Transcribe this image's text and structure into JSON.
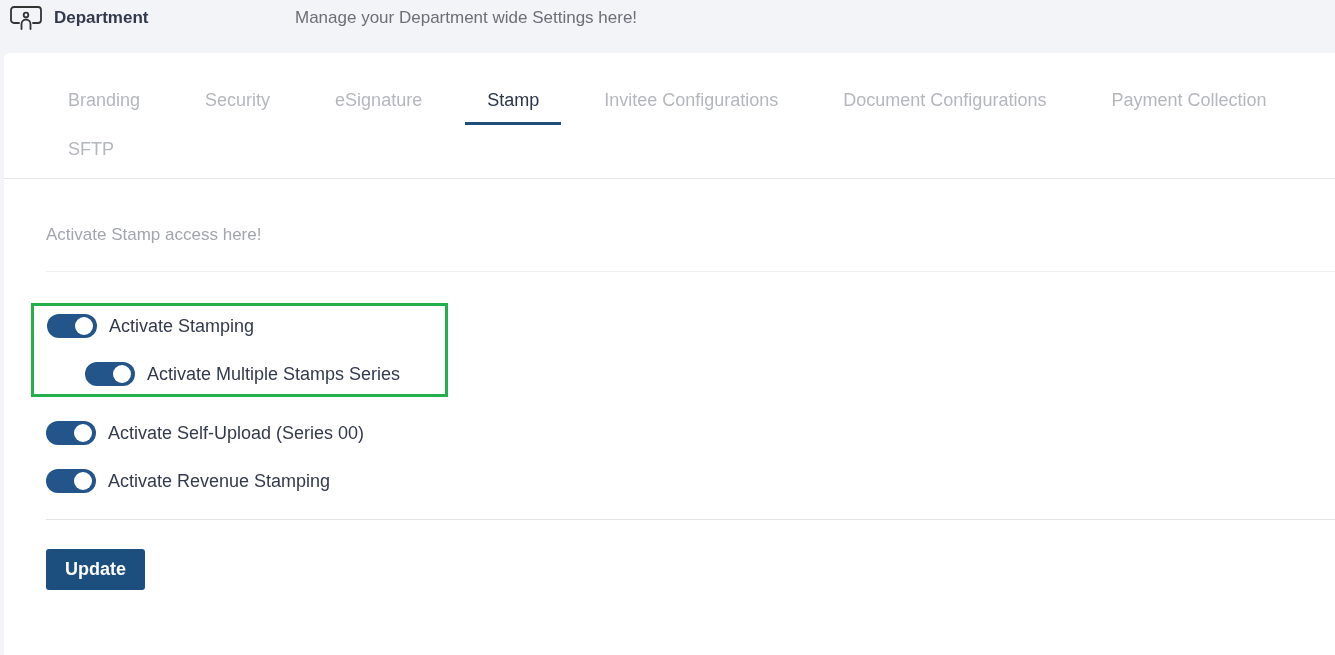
{
  "header": {
    "title": "Department",
    "subtitle": "Manage your Department wide Settings here!"
  },
  "tabs": [
    {
      "label": "Branding",
      "selected": false
    },
    {
      "label": "Security",
      "selected": false
    },
    {
      "label": "eSignature",
      "selected": false
    },
    {
      "label": "Stamp",
      "selected": true
    },
    {
      "label": "Invitee Configurations",
      "selected": false
    },
    {
      "label": "Document Configurations",
      "selected": false
    },
    {
      "label": "Payment Collection",
      "selected": false
    },
    {
      "label": "SFTP",
      "selected": false
    }
  ],
  "description": "Activate Stamp access here!",
  "toggles": [
    {
      "label": "Activate Stamping",
      "on": true,
      "highlighted": true,
      "children": [
        {
          "label": "Activate Multiple Stamps Series",
          "on": true
        }
      ]
    },
    {
      "label": "Activate Self-Upload (Series 00)",
      "on": true,
      "highlighted": false
    },
    {
      "label": "Activate Revenue Stamping",
      "on": true,
      "highlighted": false
    }
  ],
  "button": "Update"
}
